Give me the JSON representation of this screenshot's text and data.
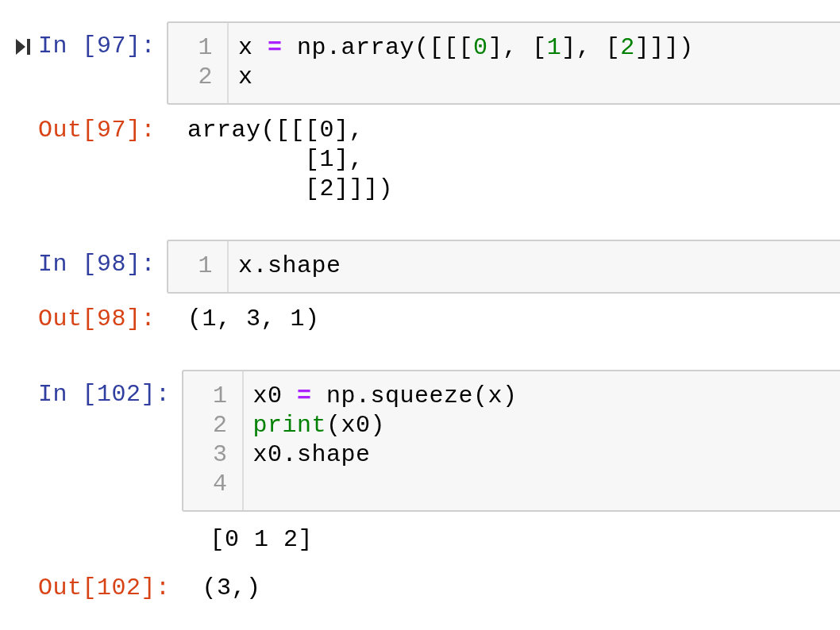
{
  "cells": [
    {
      "current": true,
      "in_prompt": "In [97]:",
      "code": [
        {
          "number": "1",
          "tokens": [
            {
              "kind": "plain",
              "text": "x "
            },
            {
              "kind": "operator",
              "text": "="
            },
            {
              "kind": "plain",
              "text": " np.array([[["
            },
            {
              "kind": "number",
              "text": "0"
            },
            {
              "kind": "plain",
              "text": "], ["
            },
            {
              "kind": "number",
              "text": "1"
            },
            {
              "kind": "plain",
              "text": "], ["
            },
            {
              "kind": "number",
              "text": "2"
            },
            {
              "kind": "plain",
              "text": "]]])"
            }
          ]
        },
        {
          "number": "2",
          "tokens": [
            {
              "kind": "plain",
              "text": "x"
            }
          ]
        }
      ],
      "outputs": [
        {
          "kind": "result",
          "prompt": "Out[97]:",
          "lines": [
            "array([[[0],",
            "        [1],",
            "        [2]]])"
          ]
        }
      ]
    },
    {
      "current": false,
      "in_prompt": "In [98]:",
      "code": [
        {
          "number": "1",
          "tokens": [
            {
              "kind": "plain",
              "text": "x.shape"
            }
          ]
        }
      ],
      "outputs": [
        {
          "kind": "result",
          "prompt": "Out[98]:",
          "lines": [
            "(1, 3, 1)"
          ]
        }
      ]
    },
    {
      "current": false,
      "in_prompt": "In [102]:",
      "code": [
        {
          "number": "1",
          "tokens": [
            {
              "kind": "plain",
              "text": "x0 "
            },
            {
              "kind": "operator",
              "text": "="
            },
            {
              "kind": "plain",
              "text": " np.squeeze(x)"
            }
          ]
        },
        {
          "number": "2",
          "tokens": [
            {
              "kind": "builtin",
              "text": "print"
            },
            {
              "kind": "plain",
              "text": "(x0)"
            }
          ]
        },
        {
          "number": "3",
          "tokens": [
            {
              "kind": "plain",
              "text": "x0.shape"
            }
          ]
        },
        {
          "number": "4"
        }
      ],
      "outputs": [
        {
          "kind": "stream",
          "lines": [
            "[0 1 2]"
          ]
        },
        {
          "kind": "result",
          "prompt": "Out[102]:",
          "lines": [
            "(3,)"
          ]
        }
      ]
    }
  ]
}
